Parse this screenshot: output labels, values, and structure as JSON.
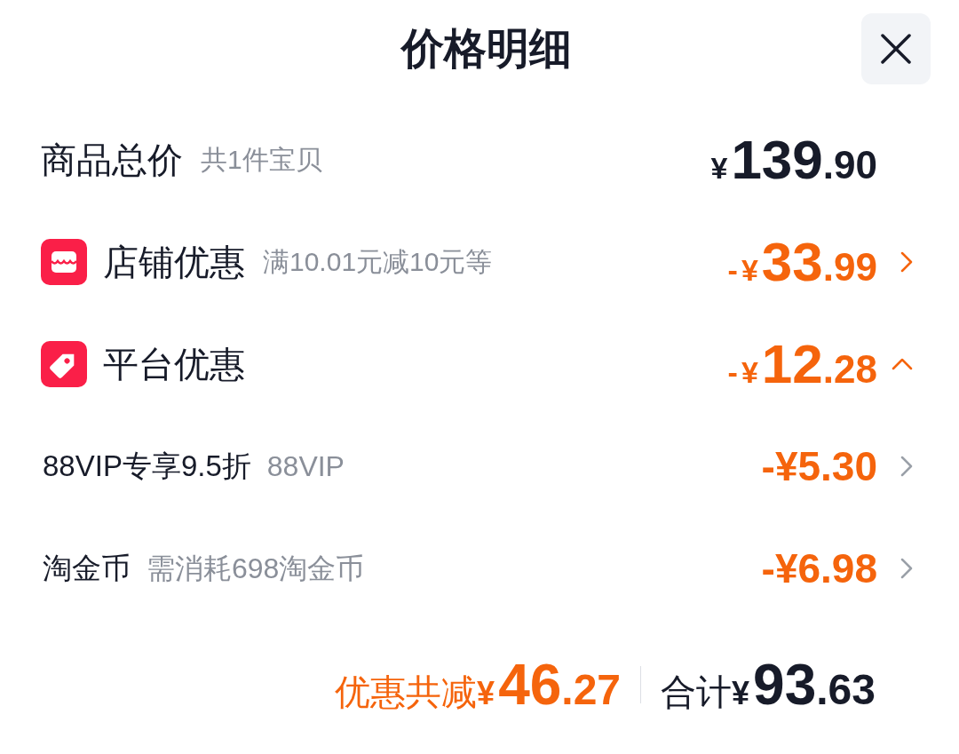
{
  "title": "价格明细",
  "lines": [
    {
      "kind": "total",
      "label": "商品总价",
      "note": "共1件宝贝",
      "amount": {
        "currency": "¥",
        "integer": "139",
        "decimal": ".90"
      }
    },
    {
      "kind": "store",
      "label": "店铺优惠",
      "note": "满10.01元减10元等",
      "amount": {
        "sign": "-",
        "currency": "¥",
        "integer": "33",
        "decimal": ".99"
      },
      "expanded": false
    },
    {
      "kind": "platform",
      "label": "平台优惠",
      "amount": {
        "sign": "-",
        "currency": "¥",
        "integer": "12",
        "decimal": ".28"
      },
      "expanded": true,
      "children": [
        {
          "label": "88VIP专享9.5折",
          "note": "88VIP",
          "amount": "-¥5.30"
        },
        {
          "label": "淘金币",
          "note": "需消耗698淘金币",
          "amount": "-¥6.98"
        }
      ]
    }
  ],
  "summary": {
    "savings": {
      "label": "优惠共减",
      "amount": {
        "currency": "¥",
        "integer": "46",
        "decimal": ".27"
      }
    },
    "total": {
      "label": "合计",
      "amount": {
        "currency": "¥",
        "integer": "93",
        "decimal": ".63"
      }
    }
  }
}
